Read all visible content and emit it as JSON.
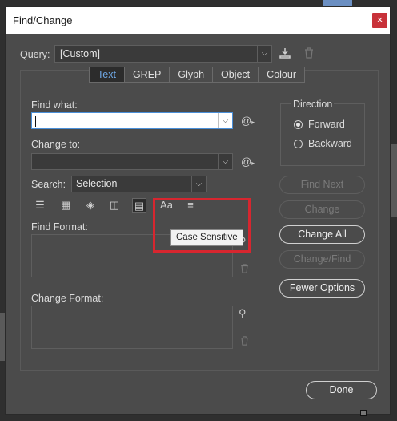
{
  "dialog": {
    "title": "Find/Change",
    "close_symbol": "×"
  },
  "query": {
    "label": "Query:",
    "value": "[Custom]"
  },
  "tabs": [
    {
      "label": "Text",
      "active": true
    },
    {
      "label": "GREP",
      "active": false
    },
    {
      "label": "Glyph",
      "active": false
    },
    {
      "label": "Object",
      "active": false
    },
    {
      "label": "Colour",
      "active": false
    }
  ],
  "find_what": {
    "label": "Find what:",
    "value": ""
  },
  "change_to": {
    "label": "Change to:",
    "value": ""
  },
  "search": {
    "label": "Search:",
    "value": "Selection"
  },
  "find_format": {
    "label": "Find Format:"
  },
  "change_format": {
    "label": "Change Format:"
  },
  "direction": {
    "label": "Direction",
    "options": [
      {
        "label": "Forward",
        "selected": true
      },
      {
        "label": "Backward",
        "selected": false
      }
    ]
  },
  "buttons": {
    "find_next": "Find Next",
    "change": "Change",
    "change_all": "Change All",
    "change_find": "Change/Find",
    "fewer_options": "Fewer Options",
    "done": "Done"
  },
  "tooltip": "Case Sensitive",
  "option_icons": [
    "include-locked-layers-icon",
    "include-locked-stories-icon",
    "include-hidden-layers-icon",
    "include-master-pages-icon",
    "include-footnotes-icon",
    "case-sensitive-icon",
    "whole-word-icon"
  ],
  "colors": {
    "highlight": "#d7262f",
    "active_tab_text": "#6fa8e6"
  }
}
